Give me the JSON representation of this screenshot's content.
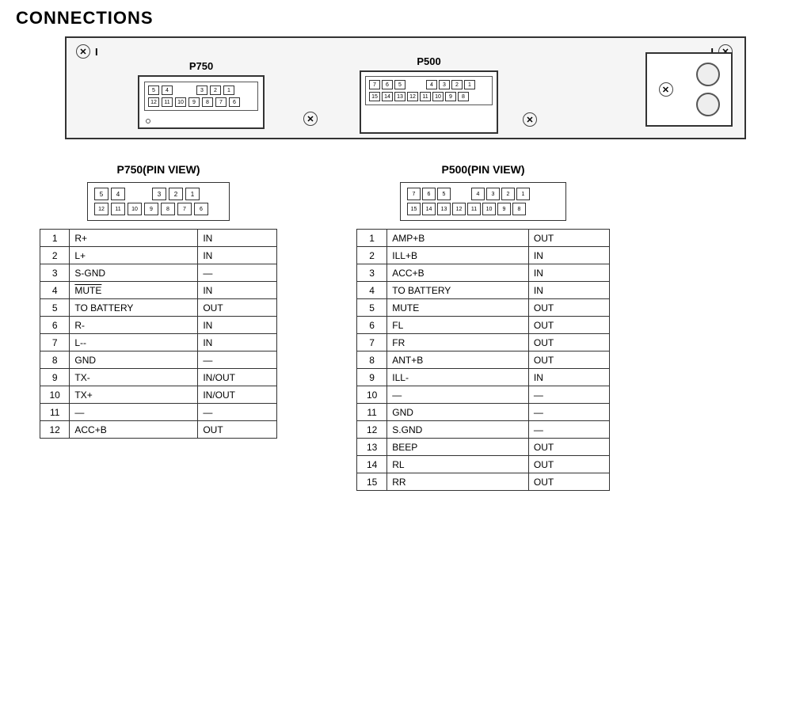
{
  "title": "CONNECTIONS",
  "connectors": {
    "p750": {
      "label": "P750",
      "pinView": "P750(PIN VIEW)",
      "topRow": [
        "5",
        "4",
        "",
        "",
        "",
        "3",
        "2",
        "1"
      ],
      "bottomRow": [
        "12",
        "11",
        "10",
        "9",
        "8",
        "7",
        "6"
      ],
      "topGap": true,
      "pins": [
        {
          "num": "1",
          "name": "R+",
          "dir": "IN"
        },
        {
          "num": "2",
          "name": "L+",
          "dir": "IN"
        },
        {
          "num": "3",
          "name": "S-GND",
          "dir": "—"
        },
        {
          "num": "4",
          "name": "MUTE",
          "dir": "IN"
        },
        {
          "num": "5",
          "name": "TO BATTERY",
          "dir": "OUT"
        },
        {
          "num": "6",
          "name": "R-",
          "dir": "IN"
        },
        {
          "num": "7",
          "name": "L--",
          "dir": "IN"
        },
        {
          "num": "8",
          "name": "GND",
          "dir": "—"
        },
        {
          "num": "9",
          "name": "TX-",
          "dir": "IN/OUT"
        },
        {
          "num": "10",
          "name": "TX+",
          "dir": "IN/OUT"
        },
        {
          "num": "11",
          "name": "—",
          "dir": "—"
        },
        {
          "num": "12",
          "name": "ACC+B",
          "dir": "OUT"
        }
      ]
    },
    "p500": {
      "label": "P500",
      "pinView": "P500(PIN VIEW)",
      "topRow": [
        "7",
        "6",
        "5",
        "",
        "",
        "4",
        "3",
        "2",
        "1"
      ],
      "bottomRow": [
        "15",
        "14",
        "13",
        "12",
        "11",
        "10",
        "9",
        "8"
      ],
      "topGap": true,
      "pins": [
        {
          "num": "1",
          "name": "AMP+B",
          "dir": "OUT"
        },
        {
          "num": "2",
          "name": "ILL+B",
          "dir": "IN"
        },
        {
          "num": "3",
          "name": "ACC+B",
          "dir": "IN"
        },
        {
          "num": "4",
          "name": "TO BATTERY",
          "dir": "IN"
        },
        {
          "num": "5",
          "name": "MUTE",
          "dir": "OUT"
        },
        {
          "num": "6",
          "name": "FL",
          "dir": "OUT"
        },
        {
          "num": "7",
          "name": "FR",
          "dir": "OUT"
        },
        {
          "num": "8",
          "name": "ANT+B",
          "dir": "OUT"
        },
        {
          "num": "9",
          "name": "ILL-",
          "dir": "IN"
        },
        {
          "num": "10",
          "name": "—",
          "dir": "—"
        },
        {
          "num": "11",
          "name": "GND",
          "dir": "—"
        },
        {
          "num": "12",
          "name": "S.GND",
          "dir": "—"
        },
        {
          "num": "13",
          "name": "BEEP",
          "dir": "OUT"
        },
        {
          "num": "14",
          "name": "RL",
          "dir": "OUT"
        },
        {
          "num": "15",
          "name": "RR",
          "dir": "OUT"
        }
      ]
    }
  }
}
